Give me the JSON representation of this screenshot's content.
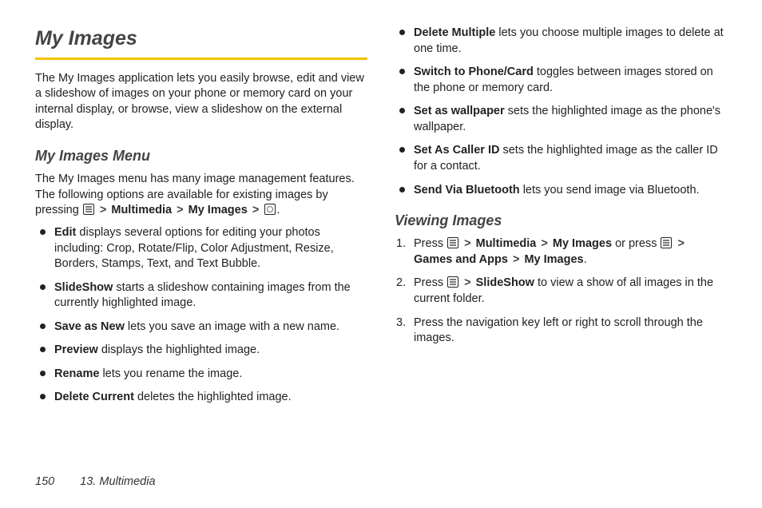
{
  "title": "My Images",
  "intro": "The My Images application lets you easily browse, edit and view a slideshow of images on your phone or memory card on your internal display, or browse, view a slideshow on the external display.",
  "section_menu_heading": "My Images Menu",
  "menu_intro_a": "The My Images menu has many image management features. The following options are available for existing images by pressing ",
  "breadcrumb1": {
    "seg1": "Multimedia",
    "seg2": "My Images"
  },
  "menu_items": [
    {
      "label": "Edit",
      "text": " displays several options for editing your photos including: Crop, Rotate/Flip, Color Adjustment, Resize, Borders, Stamps, Text, and Text Bubble."
    },
    {
      "label": "SlideShow",
      "text": " starts a slideshow containing images from the currently highlighted image."
    },
    {
      "label": "Save as New",
      "text": " lets you save an image with a new name."
    },
    {
      "label": "Preview",
      "text": " displays the highlighted image."
    },
    {
      "label": "Rename",
      "text": " lets you rename the image."
    },
    {
      "label": "Delete Current",
      "text": " deletes the highlighted image."
    },
    {
      "label": "Delete Multiple",
      "text": " lets you choose multiple images to delete at one time."
    },
    {
      "label": "Switch to Phone/Card",
      "text": " toggles between images stored on the phone or memory card."
    },
    {
      "label": "Set as wallpaper",
      "text": " sets the highlighted image as the phone's wallpaper."
    },
    {
      "label": "Set As Caller ID",
      "text": " sets the highlighted image as the caller ID for a contact."
    },
    {
      "label": "Send Via Bluetooth",
      "text": " lets you send image via Bluetooth."
    }
  ],
  "section_viewing_heading": "Viewing Images",
  "step1": {
    "pre": "Press ",
    "path_a": {
      "seg1": "Multimedia",
      "seg2": "My Images"
    },
    "mid": " or press ",
    "path_b": {
      "seg1": "Games and Apps",
      "seg2": "My Images"
    },
    "post": "."
  },
  "step2": {
    "pre": "Press ",
    "path": {
      "seg1": "SlideShow"
    },
    "post": " to view a show of all images in the current folder."
  },
  "step3": "Press the navigation key left or right to scroll through the images.",
  "footer": {
    "page": "150",
    "chapter": "13. Multimedia"
  },
  "gt": ">"
}
